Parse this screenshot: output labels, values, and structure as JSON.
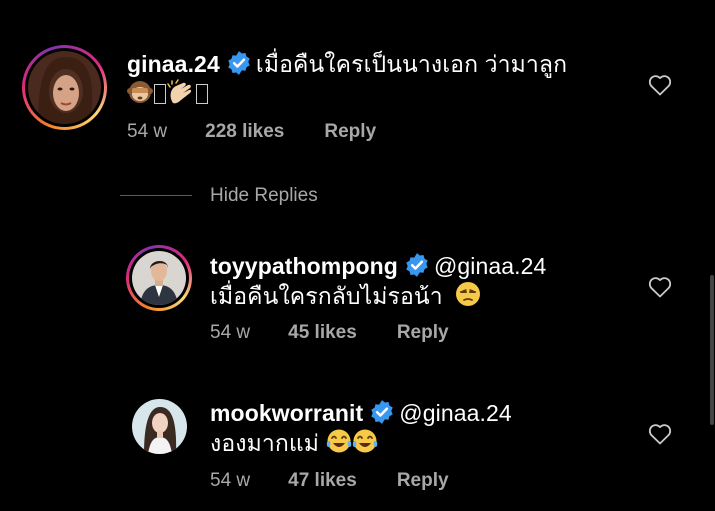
{
  "comments": [
    {
      "username": "ginaa.24",
      "mention": "",
      "text_line1": "เมื่อคืนใครเป็นนางเอก ว่ามาลูก",
      "time": "54 w",
      "likes": "228 likes",
      "reply": "Reply"
    },
    {
      "username": "toyypathompong",
      "mention": "@ginaa.24",
      "text_line2": "เมื่อคืนใครกลับไม่รอน้า",
      "time": "54 w",
      "likes": "45 likes",
      "reply": "Reply"
    },
    {
      "username": "mookworranit",
      "mention": "@ginaa.24",
      "text_line2": "งองมากแม่",
      "time": "54 w",
      "likes": "47 likes",
      "reply": "Reply"
    }
  ],
  "hide_replies": "Hide Replies",
  "icons": {
    "verified": "verified-badge-icon",
    "heart": "heart-outline-icon"
  },
  "colors": {
    "background": "#000000",
    "text": "#ffffff",
    "secondary": "#a8a8a8",
    "verified": "#3897f0"
  }
}
